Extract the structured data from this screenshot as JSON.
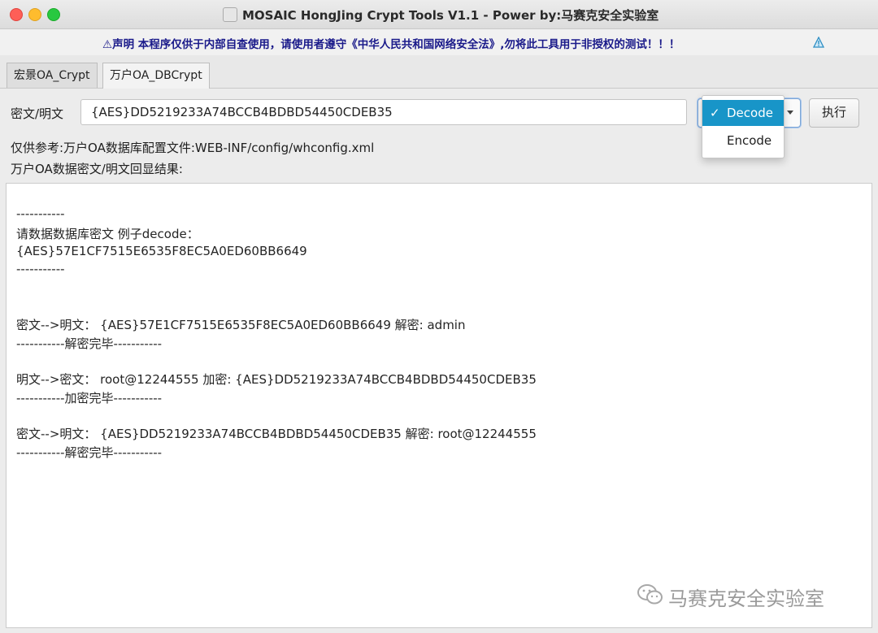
{
  "window": {
    "title": "MOSAIC HongJing Crypt Tools V1.1 - Power by:马赛克安全实验室"
  },
  "notice": {
    "text": "⚠声明 本程序仅供于内部自查使用，请使用者遵守《中华人民共和国网络安全法》,勿将此工具用于非授权的测试！！！"
  },
  "tabs": [
    {
      "label": "宏景OA_Crypt"
    },
    {
      "label": "万户OA_DBCrypt"
    }
  ],
  "form": {
    "field_label": "密文/明文",
    "input_value": "{AES}DD5219233A74BCCB4BDBD54450CDEB35",
    "select_selected": "Decode",
    "select_options": [
      "Decode",
      "Encode"
    ],
    "exec_label": "执行",
    "reference_text": "仅供参考:万户OA数据库配置文件:WEB-INF/config/whconfig.xml",
    "result_label": "万户OA数据密文/明文回显结果:"
  },
  "dropdown": {
    "check_mark": "✓",
    "items": [
      "Decode",
      "Encode"
    ]
  },
  "output": {
    "lines": [
      "-----------",
      "请数据数据库密文 例子decode：",
      "{AES}57E1CF7515E6535F8EC5A0ED60BB6649",
      "-----------",
      "密文-->明文：  {AES}57E1CF7515E6535F8EC5A0ED60BB6649   解密: admin",
      "-----------解密完毕-----------",
      "明文-->密文：  root@12244555   加密: {AES}DD5219233A74BCCB4BDBD54450CDEB35",
      "-----------加密完毕-----------",
      "密文-->明文：  {AES}DD5219233A74BCCB4BDBD54450CDEB35   解密: root@12244555",
      "-----------解密完毕-----------"
    ]
  },
  "watermark": {
    "text": "马赛克安全实验室"
  },
  "colors": {
    "accent": "#1895c8",
    "notice_text": "#1a1a8a"
  },
  "icons": {
    "notice": "warning-icon",
    "app": "app-icon",
    "watermark": "wechat-icon"
  }
}
